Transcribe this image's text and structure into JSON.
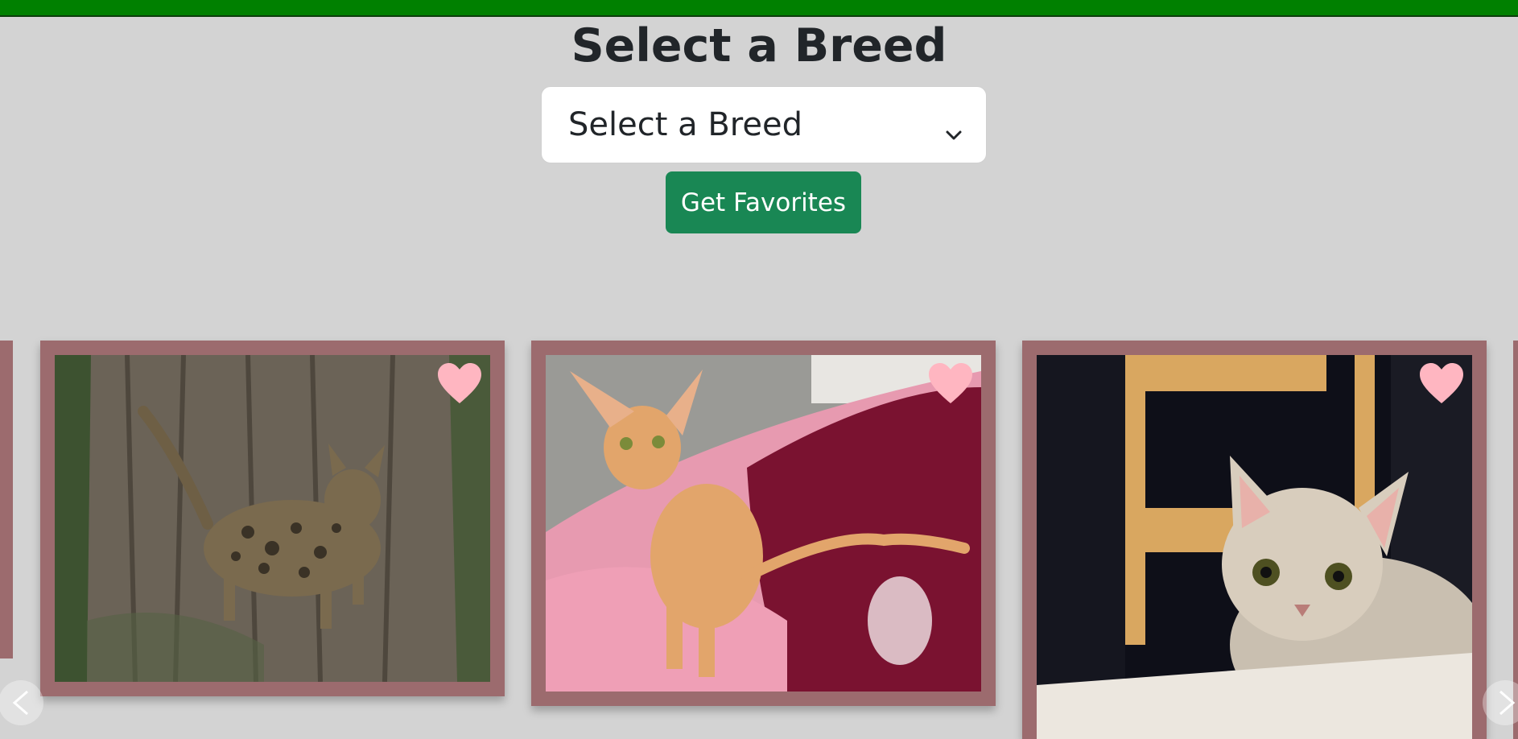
{
  "page": {
    "title": "Select a Breed",
    "accent_bar_color": "#008000"
  },
  "breed_select": {
    "selected": "Select a Breed",
    "icon": "chevron-down-icon"
  },
  "favorites_button": {
    "label": "Get Favorites",
    "color": "#198754"
  },
  "carousel": {
    "card_border_color": "#9c6b6e",
    "heart_color": "#ffb6c1",
    "cards": [
      {
        "subject": "spotted tabby cat on tree trunk",
        "favorite_icon": "heart-icon"
      },
      {
        "subject": "ginger oriental shorthair cat on pink blanket",
        "favorite_icon": "heart-icon"
      },
      {
        "subject": "cream singapura cat at table",
        "favorite_icon": "heart-icon"
      }
    ],
    "prev_icon": "chevron-left-icon",
    "next_icon": "chevron-right-icon"
  }
}
